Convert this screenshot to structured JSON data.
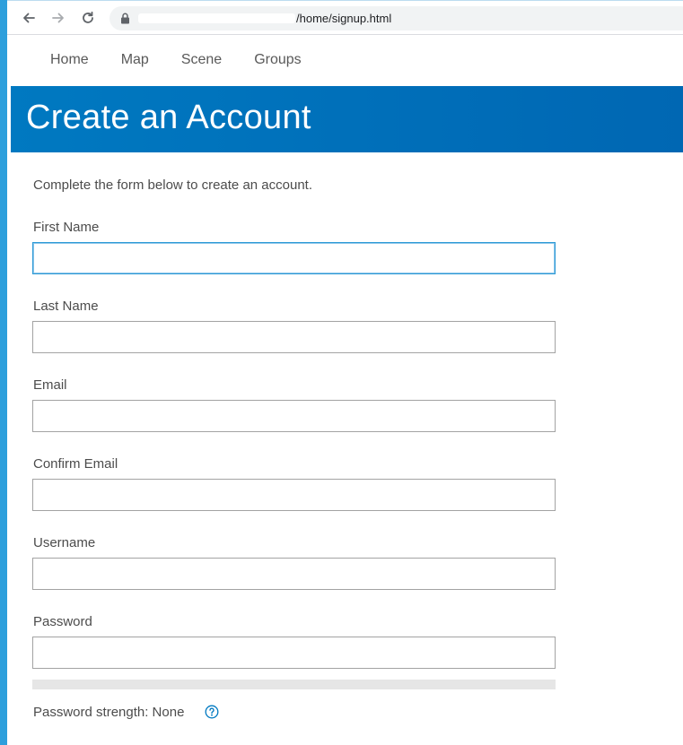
{
  "browser": {
    "url_visible": "/home/signup.html"
  },
  "nav": {
    "items": [
      "Home",
      "Map",
      "Scene",
      "Groups"
    ]
  },
  "header": {
    "title": "Create an Account"
  },
  "form": {
    "intro": "Complete the form below to create an account.",
    "fields": [
      {
        "label": "First Name",
        "value": ""
      },
      {
        "label": "Last Name",
        "value": ""
      },
      {
        "label": "Email",
        "value": ""
      },
      {
        "label": "Confirm Email",
        "value": ""
      },
      {
        "label": "Username",
        "value": ""
      },
      {
        "label": "Password",
        "value": ""
      }
    ],
    "password_strength": {
      "text": "Password strength: None",
      "level": 0
    }
  },
  "colors": {
    "header_bg": "#0079c1",
    "focus_border": "#2d9ad6",
    "frame_accent": "#2d9fdc"
  }
}
